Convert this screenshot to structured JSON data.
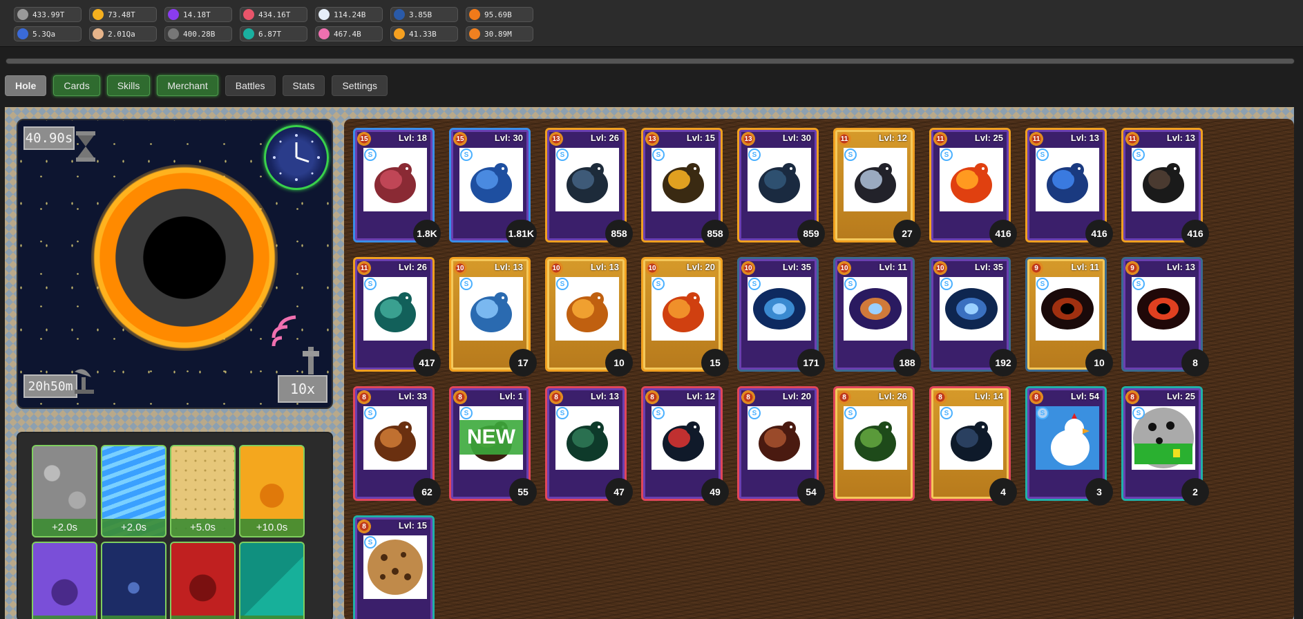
{
  "resources_row1": [
    {
      "icon": "stone-icon",
      "value": "433.99T",
      "color": "#9a9a9a"
    },
    {
      "icon": "gold-star-icon",
      "value": "73.48T",
      "color": "#f5b01e"
    },
    {
      "icon": "purple-gem-icon",
      "value": "14.18T",
      "color": "#8a3cf0"
    },
    {
      "icon": "tooth-icon",
      "value": "434.16T",
      "color": "#e8556a"
    },
    {
      "icon": "white-orb-icon",
      "value": "114.24B",
      "color": "#e6eef8"
    },
    {
      "icon": "blue-feather-icon",
      "value": "3.85B",
      "color": "#2a5aa8"
    },
    {
      "icon": "orange-feather-icon",
      "value": "95.69B",
      "color": "#f07a1a"
    }
  ],
  "resources_row2": [
    {
      "icon": "blue-branch-icon",
      "value": "5.3Qa",
      "color": "#3a6ad8"
    },
    {
      "icon": "egg-icon",
      "value": "2.01Qa",
      "color": "#e6b48a"
    },
    {
      "icon": "spark-icon",
      "value": "400.28B",
      "color": "#777777"
    },
    {
      "icon": "teal-orb-icon",
      "value": "6.87T",
      "color": "#1ab0a0"
    },
    {
      "icon": "pink-brain-icon",
      "value": "467.4B",
      "color": "#f070b0"
    },
    {
      "icon": "orange-diamond-icon",
      "value": "41.33B",
      "color": "#f5a020"
    },
    {
      "icon": "lightning-icon",
      "value": "30.89M",
      "color": "#f08020"
    }
  ],
  "tabs": [
    {
      "label": "Hole",
      "state": "active"
    },
    {
      "label": "Cards",
      "state": "green"
    },
    {
      "label": "Skills",
      "state": "green"
    },
    {
      "label": "Merchant",
      "state": "green"
    },
    {
      "label": "Battles",
      "state": "normal"
    },
    {
      "label": "Stats",
      "state": "normal"
    },
    {
      "label": "Settings",
      "state": "normal"
    }
  ],
  "hole": {
    "timer_top": "40.90s",
    "timer_bottom": "20h50m",
    "multiplier": "10x"
  },
  "upgrades": [
    {
      "label": "+2.0s",
      "theme": "stone"
    },
    {
      "label": "+2.0s",
      "theme": "water"
    },
    {
      "label": "+5.0s",
      "theme": "honeycomb"
    },
    {
      "label": "+10.0s",
      "theme": "feather"
    },
    {
      "label": "",
      "theme": "urn"
    },
    {
      "label": "",
      "theme": "star"
    },
    {
      "label": "",
      "theme": "dragon"
    },
    {
      "label": "",
      "theme": "growth"
    }
  ],
  "cards": [
    {
      "tier": "15",
      "level": "Lvl: 18",
      "count": "1.8K",
      "border": "blue",
      "frame": "purple",
      "art": "worm-icon",
      "badge": "S"
    },
    {
      "tier": "15",
      "level": "Lvl: 30",
      "count": "1.81K",
      "border": "blue",
      "frame": "purple",
      "art": "blue-feather-icon",
      "badge": "S"
    },
    {
      "tier": "13",
      "level": "Lvl: 26",
      "count": "858",
      "border": "orange",
      "frame": "purple",
      "art": "beetle-icon",
      "badge": "S"
    },
    {
      "tier": "13",
      "level": "Lvl: 15",
      "count": "858",
      "border": "orange",
      "frame": "purple",
      "art": "bee-icon",
      "badge": "S"
    },
    {
      "tier": "13",
      "level": "Lvl: 30",
      "count": "859",
      "border": "orange",
      "frame": "purple",
      "art": "moth-icon",
      "badge": "S"
    },
    {
      "tier": "11",
      "level": "Lvl: 12",
      "count": "27",
      "border": "orange",
      "frame": "gold",
      "art": "ghost-bird-icon",
      "badge": "S"
    },
    {
      "tier": "11",
      "level": "Lvl: 25",
      "count": "416",
      "border": "orange",
      "frame": "purple",
      "art": "phoenix-icon",
      "badge": "S"
    },
    {
      "tier": "11",
      "level": "Lvl: 13",
      "count": "416",
      "border": "orange",
      "frame": "purple",
      "art": "blue-bird-icon",
      "badge": "S"
    },
    {
      "tier": "11",
      "level": "Lvl: 13",
      "count": "416",
      "border": "orange",
      "frame": "purple",
      "art": "crow-icon",
      "badge": "S"
    },
    {
      "tier": "11",
      "level": "Lvl: 26",
      "count": "417",
      "border": "orange",
      "frame": "purple",
      "art": "teal-griffin-icon",
      "badge": "S"
    },
    {
      "tier": "10",
      "level": "Lvl: 13",
      "count": "17",
      "border": "orange",
      "frame": "gold",
      "art": "blue-wing-bird-icon",
      "badge": "S"
    },
    {
      "tier": "10",
      "level": "Lvl: 13",
      "count": "10",
      "border": "orange",
      "frame": "gold",
      "art": "sun-creature-icon",
      "badge": "S"
    },
    {
      "tier": "10",
      "level": "Lvl: 20",
      "count": "15",
      "border": "orange",
      "frame": "gold",
      "art": "fire-bird-icon",
      "badge": "S"
    },
    {
      "tier": "10",
      "level": "Lvl: 35",
      "count": "171",
      "border": "steel",
      "frame": "purple",
      "art": "galaxy-icon",
      "badge": "S"
    },
    {
      "tier": "10",
      "level": "Lvl: 11",
      "count": "188",
      "border": "steel",
      "frame": "purple",
      "art": "purple-galaxy-icon",
      "badge": "S"
    },
    {
      "tier": "10",
      "level": "Lvl: 35",
      "count": "192",
      "border": "steel",
      "frame": "purple",
      "art": "nebula-icon",
      "badge": "S"
    },
    {
      "tier": "9",
      "level": "Lvl: 11",
      "count": "10",
      "border": "steel",
      "frame": "gold",
      "art": "dark-hole-icon",
      "badge": "S"
    },
    {
      "tier": "9",
      "level": "Lvl: 13",
      "count": "8",
      "border": "steel",
      "frame": "purple",
      "art": "red-hole-icon",
      "badge": "S"
    },
    {
      "tier": "8",
      "level": "Lvl: 33",
      "count": "62",
      "border": "red",
      "frame": "purple",
      "art": "lion-icon",
      "badge": "S"
    },
    {
      "tier": "8",
      "level": "Lvl: 1",
      "count": "55",
      "border": "red",
      "frame": "purple",
      "art": "beast-icon",
      "badge": "S",
      "new": "NEW"
    },
    {
      "tier": "8",
      "level": "Lvl: 13",
      "count": "47",
      "border": "red",
      "frame": "purple",
      "art": "green-dragon-icon",
      "badge": "S"
    },
    {
      "tier": "8",
      "level": "Lvl: 12",
      "count": "49",
      "border": "red",
      "frame": "purple",
      "art": "rooster-icon",
      "badge": "S"
    },
    {
      "tier": "8",
      "level": "Lvl: 20",
      "count": "54",
      "border": "red",
      "frame": "purple",
      "art": "bear-icon",
      "badge": "S"
    },
    {
      "tier": "8",
      "level": "Lvl: 26",
      "count": "",
      "border": "red",
      "frame": "gold",
      "art": "wyvern-icon",
      "badge": "S"
    },
    {
      "tier": "8",
      "level": "Lvl: 14",
      "count": "4",
      "border": "red",
      "frame": "gold",
      "art": "serpent-icon",
      "badge": "S"
    },
    {
      "tier": "8",
      "level": "Lvl: 54",
      "count": "3",
      "border": "teal",
      "frame": "purple",
      "art": "chicken-icon",
      "badge": "S"
    },
    {
      "tier": "8",
      "level": "Lvl: 25",
      "count": "2",
      "border": "teal",
      "frame": "purple",
      "art": "minesweeper-icon",
      "badge": "S"
    },
    {
      "tier": "8",
      "level": "Lvl: 15",
      "count": "",
      "border": "teal",
      "frame": "purple",
      "art": "cookie-icon",
      "badge": "S"
    }
  ]
}
